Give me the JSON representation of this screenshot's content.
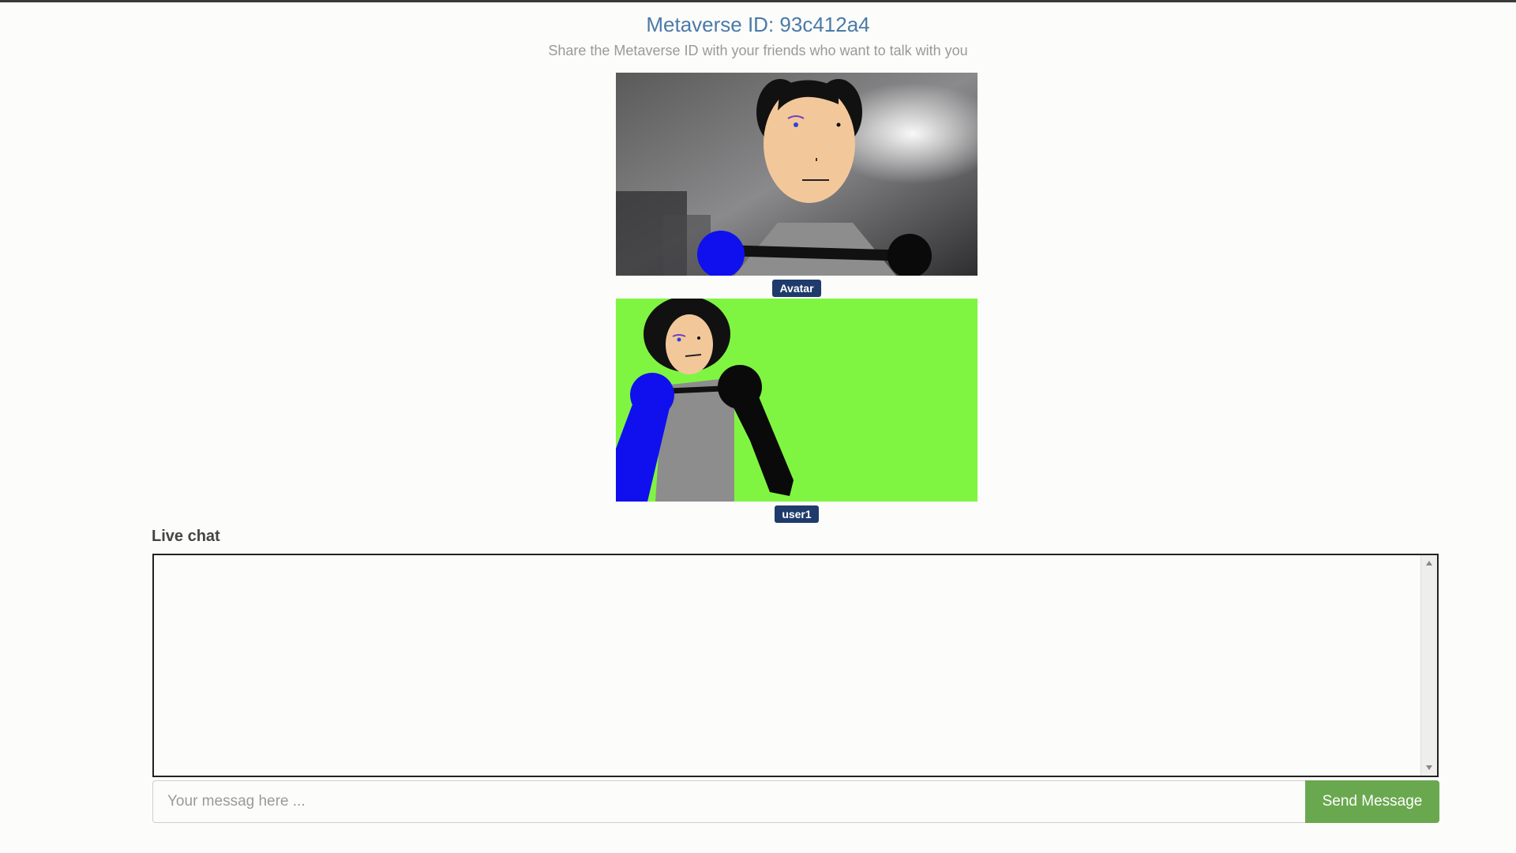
{
  "header": {
    "title": "Metaverse ID: 93c412a4",
    "subtitle": "Share the Metaverse ID with your friends who want to talk with you"
  },
  "videos": [
    {
      "label": "Avatar"
    },
    {
      "label": "user1"
    }
  ],
  "chat": {
    "heading": "Live chat",
    "input_placeholder": "Your messag here ...",
    "input_value": "",
    "send_label": "Send Message"
  },
  "colors": {
    "title": "#4a7aa8",
    "label_bg": "#1f3b6b",
    "send_button": "#6aa84f",
    "green_screen": "#7ff542"
  },
  "icons": [
    "scroll-up-arrow-icon",
    "scroll-down-arrow-icon"
  ]
}
